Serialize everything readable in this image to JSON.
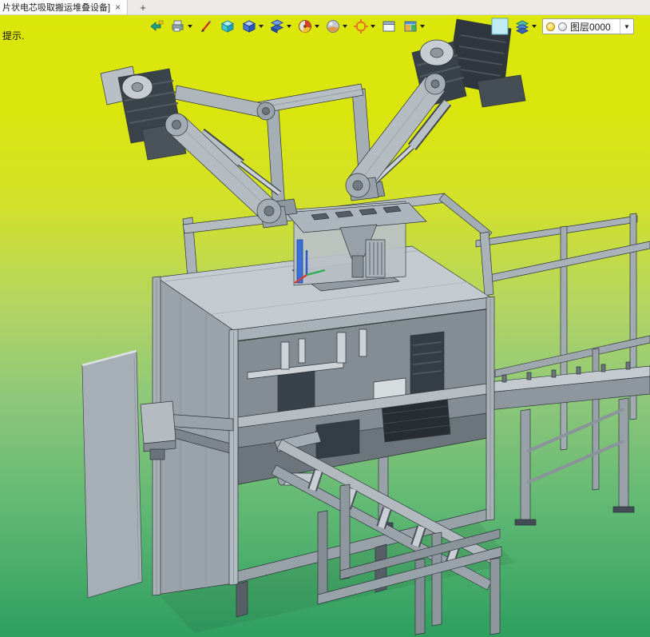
{
  "window": {
    "tabbar": {
      "document_title": "片状电芯吸取搬运堆叠设备]",
      "close_glyph": "×",
      "new_tab_glyph": "+"
    }
  },
  "toolbar": {
    "icons": [
      {
        "name": "open-file-icon"
      },
      {
        "name": "display-style-icon",
        "has_dropdown": true
      },
      {
        "name": "sketch-pen-icon"
      },
      {
        "name": "solid-cube-icon"
      },
      {
        "name": "feature-cube-icon",
        "has_dropdown": true
      },
      {
        "name": "boolean-layers-icon",
        "has_dropdown": true
      },
      {
        "name": "color-wheel-icon",
        "has_dropdown": true
      },
      {
        "name": "material-sphere-icon",
        "has_dropdown": true
      },
      {
        "name": "snap-target-icon",
        "has_dropdown": true
      },
      {
        "name": "view-window-icon"
      },
      {
        "name": "render-window-icon",
        "has_dropdown": true
      },
      {
        "name": "selection-highlight-icon"
      },
      {
        "name": "display-stack-icon",
        "has_dropdown": true
      }
    ],
    "layer_selector": {
      "value": "图层0000",
      "dropdown_glyph": "▼"
    }
  },
  "viewport": {
    "hint": "提示.",
    "background_top": "#dce70a",
    "background_bottom": "#2f9f60",
    "model_parts": [
      "left-robot-arm",
      "right-robot-arm",
      "center-feeder-tower",
      "machine-frame",
      "right-conveyor",
      "front-conveyor-frame",
      "left-side-panel",
      "right-storage-frame"
    ]
  }
}
